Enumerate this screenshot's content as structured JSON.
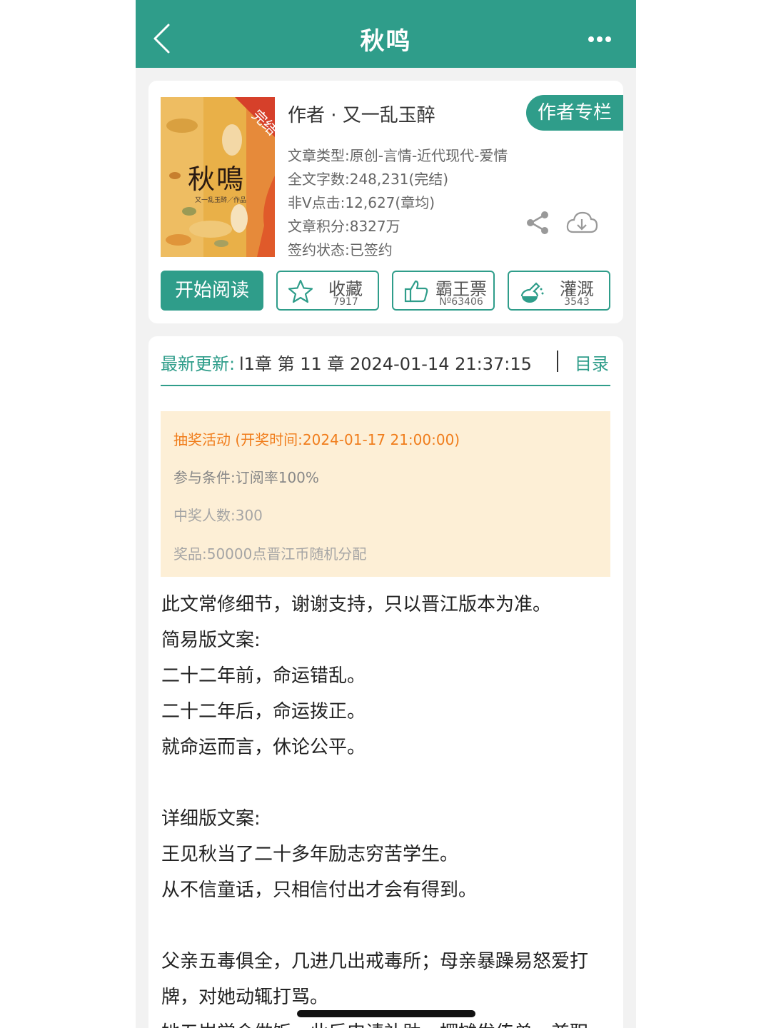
{
  "nav": {
    "title": "秋鸣"
  },
  "book": {
    "cover_title": "秋鳴",
    "cover_sub": "又一乱玉醉／作品",
    "cover_badge": "完结",
    "author_line": "作者 · 又一乱玉醉",
    "author_column_btn": "作者专栏",
    "meta": [
      "文章类型:原创-言情-近代现代-爱情",
      "全文字数:248,231(完结)",
      "非Ⅴ点击:12,627(章均)",
      "文章积分:8327万",
      "签约状态:已签约"
    ]
  },
  "actions": {
    "read": "开始阅读",
    "favorite": {
      "label": "收藏",
      "count": "7917"
    },
    "vote": {
      "label": "霸王票",
      "count": "Nº63406"
    },
    "irrigate": {
      "label": "灌溉",
      "count": "3543"
    }
  },
  "update": {
    "label": "最新更新:",
    "text": "l1章 第 11 章 2024-01-14 21:37:15 ⁝",
    "toc": "目录"
  },
  "lottery": {
    "title": "抽奖活动 (开奖时间:2024-01-17 21:00:00)",
    "condition": "参与条件:订阅率100%",
    "winners": "中奖人数:300",
    "prize": "奖品:50000点晋江币随机分配"
  },
  "description": [
    "此文常修细节，谢谢支持，只以晋江版本为准。",
    "简易版文案:",
    "二十二年前，命运错乱。",
    "二十二年后，命运拨正。",
    "就命运而言，休论公平。",
    "详细版文案:",
    "王见秋当了二十多年励志穷苦学生。",
    "从不信童话，只相信付出才会有得到。",
    "父亲五毒俱全，几进几出戒毒所；母亲暴躁易怒爱打",
    "牌，对她动辄打骂。",
    "她五岁学会做饭，此后申请补助，摆摊发传单，兼职"
  ],
  "colors": {
    "accent": "#2f9d8a",
    "lottery_bg": "#fdefd6",
    "lottery_title": "#f07d1c"
  }
}
